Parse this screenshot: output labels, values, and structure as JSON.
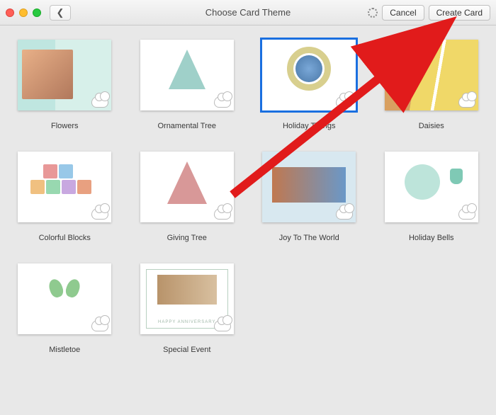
{
  "window": {
    "title": "Choose Card Theme",
    "buttons": {
      "cancel": "Cancel",
      "create": "Create Card"
    }
  },
  "cards": [
    {
      "label": "Flowers",
      "selected": false,
      "klass": "flowers"
    },
    {
      "label": "Ornamental Tree",
      "selected": false,
      "klass": "ornamental"
    },
    {
      "label": "Holiday Tidings",
      "selected": true,
      "klass": "holiday"
    },
    {
      "label": "Daisies",
      "selected": false,
      "klass": "daisies"
    },
    {
      "label": "Colorful Blocks",
      "selected": false,
      "klass": "colorful"
    },
    {
      "label": "Giving Tree",
      "selected": false,
      "klass": "giving"
    },
    {
      "label": "Joy To The World",
      "selected": false,
      "klass": "joy"
    },
    {
      "label": "Holiday Bells",
      "selected": false,
      "klass": "bells"
    },
    {
      "label": "Mistletoe",
      "selected": false,
      "klass": "mistle"
    },
    {
      "label": "Special Event",
      "selected": false,
      "klass": "special"
    }
  ],
  "annotation": {
    "color": "#e11b1b"
  }
}
